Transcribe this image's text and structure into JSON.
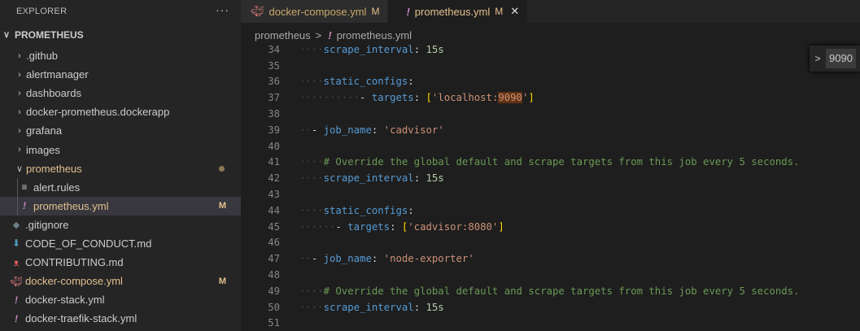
{
  "sidebar": {
    "title": "EXPLORER",
    "more": "···",
    "project": "PROMETHEUS",
    "items": [
      {
        "label": ".github",
        "type": "folder"
      },
      {
        "label": "alertmanager",
        "type": "folder"
      },
      {
        "label": "dashboards",
        "type": "folder"
      },
      {
        "label": "docker-prometheus.dockerapp",
        "type": "folder"
      },
      {
        "label": "grafana",
        "type": "folder"
      },
      {
        "label": "images",
        "type": "folder"
      },
      {
        "label": "prometheus",
        "type": "folder-open"
      },
      {
        "label": "alert.rules",
        "type": "file",
        "icon": "lines-icon"
      },
      {
        "label": "prometheus.yml",
        "type": "file",
        "icon": "yaml-icon",
        "badge": "M"
      },
      {
        "label": ".gitignore",
        "type": "file",
        "icon": "git-icon"
      },
      {
        "label": "CODE_OF_CONDUCT.md",
        "type": "file",
        "icon": "download-arrow-icon"
      },
      {
        "label": "CONTRIBUTING.md",
        "type": "file",
        "icon": "contributing-icon"
      },
      {
        "label": "docker-compose.yml",
        "type": "file",
        "icon": "docker-icon",
        "badge": "M"
      },
      {
        "label": "docker-stack.yml",
        "type": "file",
        "icon": "yaml-icon"
      },
      {
        "label": "docker-traefik-stack.yml",
        "type": "file",
        "icon": "yaml-icon"
      }
    ]
  },
  "tabs": [
    {
      "label": "docker-compose.yml",
      "badge": "M",
      "icon": "docker-icon"
    },
    {
      "label": "prometheus.yml",
      "badge": "M",
      "icon": "yaml-icon",
      "close": "✕"
    }
  ],
  "breadcrumb": {
    "folder": "prometheus",
    "separator": ">",
    "file": "prometheus.yml"
  },
  "find": {
    "chevron": ">",
    "query": "9090"
  },
  "code": {
    "lines": [
      {
        "n": "34",
        "text": "    scrape_interval: 15s"
      },
      {
        "n": "35",
        "text": ""
      },
      {
        "n": "36",
        "text": "    static_configs:"
      },
      {
        "n": "37",
        "text": "          - targets: ['localhost:9090']"
      },
      {
        "n": "38",
        "text": ""
      },
      {
        "n": "39",
        "text": "  - job_name: 'cadvisor'"
      },
      {
        "n": "40",
        "text": ""
      },
      {
        "n": "41",
        "text": "    # Override the global default and scrape targets from this job every 5 seconds."
      },
      {
        "n": "42",
        "text": "    scrape_interval: 15s"
      },
      {
        "n": "43",
        "text": ""
      },
      {
        "n": "44",
        "text": "    static_configs:"
      },
      {
        "n": "45",
        "text": "      - targets: ['cadvisor:8080']"
      },
      {
        "n": "46",
        "text": ""
      },
      {
        "n": "47",
        "text": "  - job_name: 'node-exporter'"
      },
      {
        "n": "48",
        "text": ""
      },
      {
        "n": "49",
        "text": "    # Override the global default and scrape targets from this job every 5 seconds."
      },
      {
        "n": "50",
        "text": "    scrape_interval: 15s"
      },
      {
        "n": "51",
        "text": ""
      }
    ]
  },
  "colors": {
    "modified": "#e2c08d",
    "keyword": "#569cd6",
    "string": "#ce9178",
    "comment": "#6a9955",
    "number": "#b5cea8",
    "match_highlight": "#613214"
  }
}
